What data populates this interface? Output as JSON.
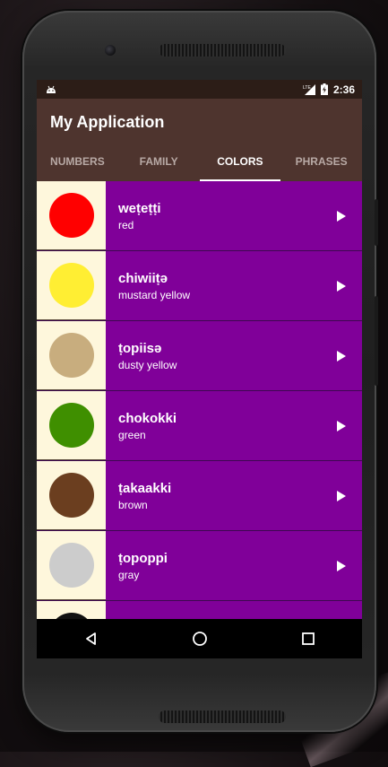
{
  "status_bar": {
    "time": "2:36",
    "network_label": "LTE",
    "icons": [
      "android-icon",
      "lte-signal-icon",
      "battery-charging-icon"
    ]
  },
  "app": {
    "title": "My Application",
    "colors": {
      "status_bar": "#2c1d17",
      "app_bar": "#4e342e",
      "item_background": "#800099",
      "image_background": "#fef7dc"
    }
  },
  "tabs": [
    {
      "label": "NUMBERS",
      "active": false
    },
    {
      "label": "FAMILY",
      "active": false
    },
    {
      "label": "COLORS",
      "active": true
    },
    {
      "label": "PHRASES",
      "active": false
    }
  ],
  "items": [
    {
      "miwok": "weṭeṭṭi",
      "english": "red",
      "swatch": "#ff0000"
    },
    {
      "miwok": "chiwiiṭə",
      "english": "mustard yellow",
      "swatch": "#ffee33"
    },
    {
      "miwok": "ṭopiisə",
      "english": "dusty yellow",
      "swatch": "#c8ad7e"
    },
    {
      "miwok": "chokokki",
      "english": "green",
      "swatch": "#3f8f00"
    },
    {
      "miwok": "ṭakaakki",
      "english": "brown",
      "swatch": "#6b3e1f"
    },
    {
      "miwok": "ṭopoppi",
      "english": "gray",
      "swatch": "#cccccc"
    },
    {
      "miwok": "",
      "english": "",
      "swatch": "#111111"
    }
  ],
  "nav_bar": {
    "buttons": [
      "back-icon",
      "home-icon",
      "recents-icon"
    ]
  }
}
